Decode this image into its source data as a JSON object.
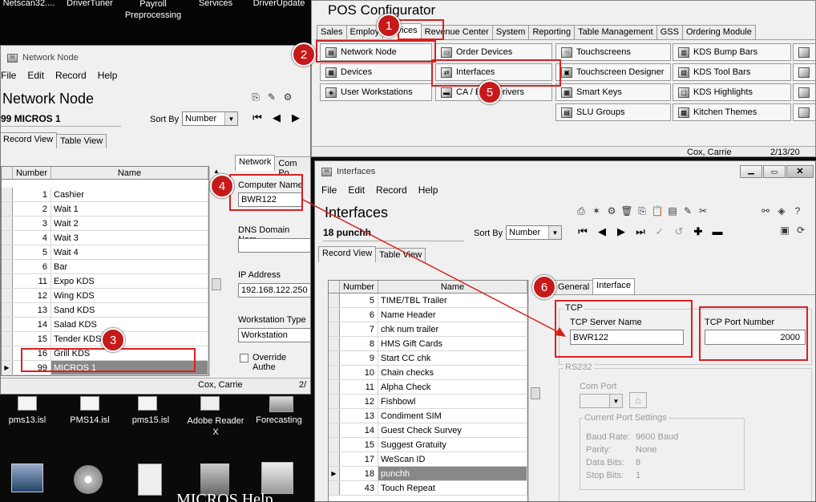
{
  "desktop": {
    "top_icons": [
      "Netscan32....",
      "DriverTuner",
      "Payroll\nPreprocessing",
      "Services",
      "DriverUpdate"
    ],
    "bottom_icons": [
      "pms13.isl",
      "PMS14.isl",
      "pms15.isl",
      "Adobe Reader\nX",
      "Forecasting"
    ],
    "bottom_row2": [
      "MICROS Help"
    ]
  },
  "pos": {
    "title": "POS Configurator",
    "tabs": [
      "Sales",
      "Employ",
      "Devices",
      "Revenue Center",
      "System",
      "Reporting",
      "Table Management",
      "GSS",
      "Ordering Module"
    ],
    "buttons": {
      "network_node": "Network Node",
      "devices": "Devices",
      "user_workstations": "User Workstations",
      "order_devices": "Order Devices",
      "interfaces": "Interfaces",
      "ca_drivers": "CA / EDC Drivers",
      "touchscreens": "Touchscreens",
      "touchscreen_designer": "Touchscreen Designer",
      "smart_keys": "Smart Keys",
      "slu_groups": "SLU Groups",
      "kds_bump_bars": "KDS Bump Bars",
      "kds_tool_bars": "KDS Tool Bars",
      "kds_highlights": "KDS Highlights",
      "kitchen_themes": "Kitchen Themes"
    },
    "status_user": "Cox, Carrie",
    "status_date": "2/13/20"
  },
  "network_node": {
    "window_title": "Network Node",
    "menu": [
      "File",
      "Edit",
      "Record",
      "Help"
    ],
    "big_title": "Network Node",
    "record_label": "99 MICROS 1",
    "sort_by_label": "Sort By",
    "sort_by_value": "Number",
    "tabs": [
      "Record View",
      "Table View"
    ],
    "right_tabs": [
      "Network",
      "Com Po"
    ],
    "columns": [
      "Number",
      "Name"
    ],
    "rows": [
      {
        "num": "1",
        "name": "Cashier"
      },
      {
        "num": "2",
        "name": "Wait 1"
      },
      {
        "num": "3",
        "name": "Wait 2"
      },
      {
        "num": "4",
        "name": "Wait 3"
      },
      {
        "num": "5",
        "name": "Wait 4"
      },
      {
        "num": "6",
        "name": "Bar"
      },
      {
        "num": "11",
        "name": "Expo KDS"
      },
      {
        "num": "12",
        "name": "Wing KDS"
      },
      {
        "num": "13",
        "name": "Sand KDS"
      },
      {
        "num": "14",
        "name": "Salad KDS"
      },
      {
        "num": "15",
        "name": "Tender KDS"
      },
      {
        "num": "16",
        "name": "Grill KDS"
      },
      {
        "num": "99",
        "name": "MICROS 1"
      }
    ],
    "computer_name_label": "Computer Name",
    "computer_name_value": "BWR122",
    "dns_label": "DNS Domain Nam",
    "ip_label": "IP Address",
    "ip_value": "192.168.122.250",
    "ws_type_label": "Workstation Type",
    "ws_type_value": "Workstation",
    "override_label": "Override Authe",
    "status_user": "Cox, Carrie",
    "status_date": "2/"
  },
  "interfaces": {
    "window_title": "Interfaces",
    "menu": [
      "File",
      "Edit",
      "Record",
      "Help"
    ],
    "big_title": "Interfaces",
    "record_label": "18 punchh",
    "sort_by_label": "Sort By",
    "sort_by_value": "Number",
    "tabs": [
      "Record View",
      "Table View"
    ],
    "right_tabs": [
      "General",
      "Interface"
    ],
    "columns": [
      "Number",
      "Name"
    ],
    "rows": [
      {
        "num": "5",
        "name": "TIME/TBL Trailer"
      },
      {
        "num": "6",
        "name": "Name Header"
      },
      {
        "num": "7",
        "name": "chk num trailer"
      },
      {
        "num": "8",
        "name": "HMS Gift Cards"
      },
      {
        "num": "9",
        "name": "Start CC chk"
      },
      {
        "num": "10",
        "name": "Chain checks"
      },
      {
        "num": "11",
        "name": "Alpha Check"
      },
      {
        "num": "12",
        "name": "Fishbowl"
      },
      {
        "num": "13",
        "name": "Condiment SIM"
      },
      {
        "num": "14",
        "name": "Guest Check Survey"
      },
      {
        "num": "15",
        "name": "Suggest Gratuity"
      },
      {
        "num": "17",
        "name": "WeScan ID"
      },
      {
        "num": "18",
        "name": "punchh"
      },
      {
        "num": "43",
        "name": "Touch Repeat"
      }
    ],
    "tcp_group": "TCP",
    "tcp_server_label": "TCP Server Name",
    "tcp_server_value": "BWR122",
    "tcp_port_label": "TCP Port Number",
    "tcp_port_value": "2000",
    "rs232_group": "RS232",
    "com_port_label": "Com Port",
    "current_port_label": "Current Port Settings",
    "baud_label": "Baud Rate:",
    "baud_value": "9600 Baud",
    "parity_label": "Parity:",
    "parity_value": "None",
    "data_bits_label": "Data Bits:",
    "data_bits_value": "8",
    "stop_bits_label": "Stop Bits:",
    "stop_bits_value": "1"
  },
  "callouts": [
    "1",
    "2",
    "3",
    "4",
    "5",
    "6"
  ],
  "colors": {
    "annotation_red": "#d82020",
    "callout_fill": "#c61a1a",
    "selected_row": "#888888"
  }
}
